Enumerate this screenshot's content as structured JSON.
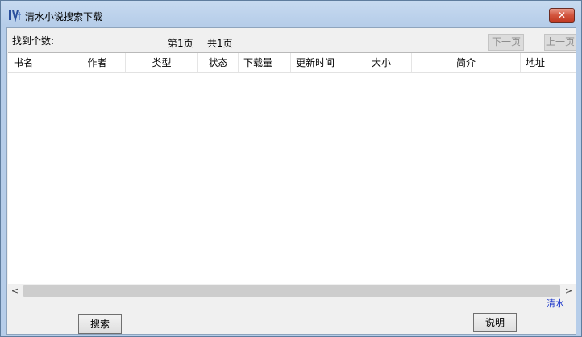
{
  "window": {
    "title": "清水小说搜索下载",
    "icon": "app-logo-icon",
    "close_glyph": "✕"
  },
  "toolbar": {
    "found_label": "找到个数:",
    "current_page": "第1页",
    "total_pages": "共1页",
    "next_page_label": "下一页",
    "prev_page_label": "上一页"
  },
  "table": {
    "columns": [
      "书名",
      "作者",
      "类型",
      "状态",
      "下载量",
      "更新时间",
      "大小",
      "简介",
      "地址"
    ],
    "rows": []
  },
  "scrollbar": {
    "left_arrow": "<",
    "right_arrow": ">"
  },
  "footer": {
    "search_label": "搜索",
    "help_label": "说明",
    "link_text": "清水"
  }
}
